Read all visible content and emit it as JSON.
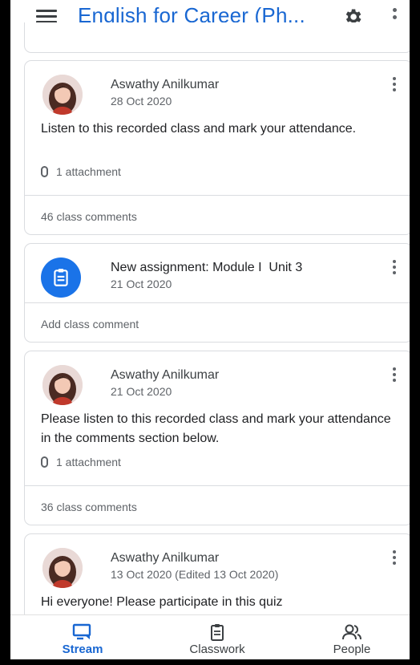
{
  "app_bar": {
    "title": "English for Career (Ph..."
  },
  "posts": [
    {
      "author": "Aswathy Anilkumar",
      "date": "28 Oct 2020",
      "body": "Listen to this recorded class and mark your attendance.",
      "attachments": "1 attachment",
      "comments": "46 class comments"
    },
    {
      "title": "New assignment: Module I  Unit 3",
      "date": "21 Oct 2020",
      "comment_prompt": "Add class comment"
    },
    {
      "author": "Aswathy Anilkumar",
      "date": "21 Oct 2020",
      "body": "Please listen to this recorded class and mark your attendance in the comments section below.",
      "attachments": "1 attachment",
      "comments": "36 class comments"
    },
    {
      "author": "Aswathy Anilkumar",
      "date": "13 Oct 2020 (Edited 13 Oct 2020)",
      "body": "Hi everyone! Please participate in this quiz"
    }
  ],
  "bottom_nav": {
    "stream": "Stream",
    "classwork": "Classwork",
    "people": "People",
    "active": "stream"
  },
  "colors": {
    "accent": "#1967d2",
    "assignment_icon_bg": "#1a73e8",
    "divider": "#dadce0"
  },
  "icons": [
    "menu-icon",
    "gear-icon",
    "more-vert-icon",
    "assignment-icon",
    "paperclip-icon",
    "stream-icon",
    "classwork-icon",
    "people-icon"
  ]
}
